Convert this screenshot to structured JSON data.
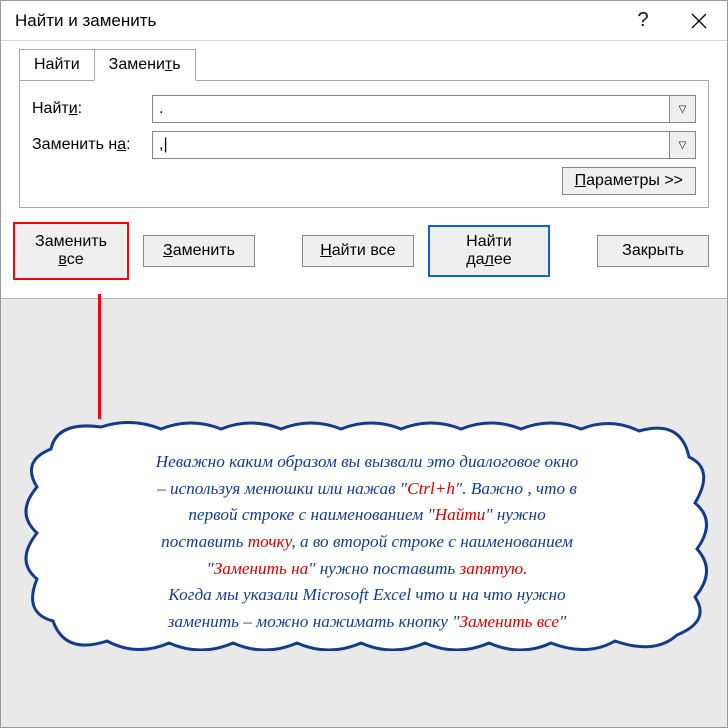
{
  "titlebar": {
    "title": "Найти и заменить"
  },
  "tabs": {
    "find": "Найти",
    "replace": "Заменить"
  },
  "fields": {
    "find_label_pre": "Найт",
    "find_label_u": "и",
    "find_label_post": ":",
    "find_value": ".",
    "replace_label_pre": "Заменить н",
    "replace_label_u": "а",
    "replace_label_post": ":",
    "replace_value": ",|"
  },
  "params": {
    "label_u": "П",
    "label_post": "араметры >>"
  },
  "buttons": {
    "replace_all_pre": "Заменить ",
    "replace_all_u": "в",
    "replace_all_post": "се",
    "replace_u": "З",
    "replace_post": "аменить",
    "find_all_u": "Н",
    "find_all_post": "айти все",
    "find_next_pre": "Найти да",
    "find_next_u": "л",
    "find_next_post": "ее",
    "close": "Закрыть"
  },
  "callout": {
    "l1a": "Неважно каким образом вы вызвали это диалоговое окно",
    "l2a": "– используя менюшки или нажав \"",
    "l2b": "Ctrl+h",
    "l2c": "\". Важно , что в",
    "l3a": "первой строке с наименованием \"",
    "l3b": "Найти",
    "l3c": "\" нужно",
    "l4a": "поставить ",
    "l4b": "точку",
    "l4c": ", а во второй строке с наименованием",
    "l5a": "\"",
    "l5b": "Заменить на",
    "l5c": "\" нужно поставить ",
    "l5d": "запятую",
    "l5e": ".",
    "l6a": "Когда мы указали  Microsoft Excel  что и на что нужно",
    "l7a": "заменить  – можно нажимать кнопку  \"",
    "l7b": "Заменить все",
    "l7c": "\""
  }
}
